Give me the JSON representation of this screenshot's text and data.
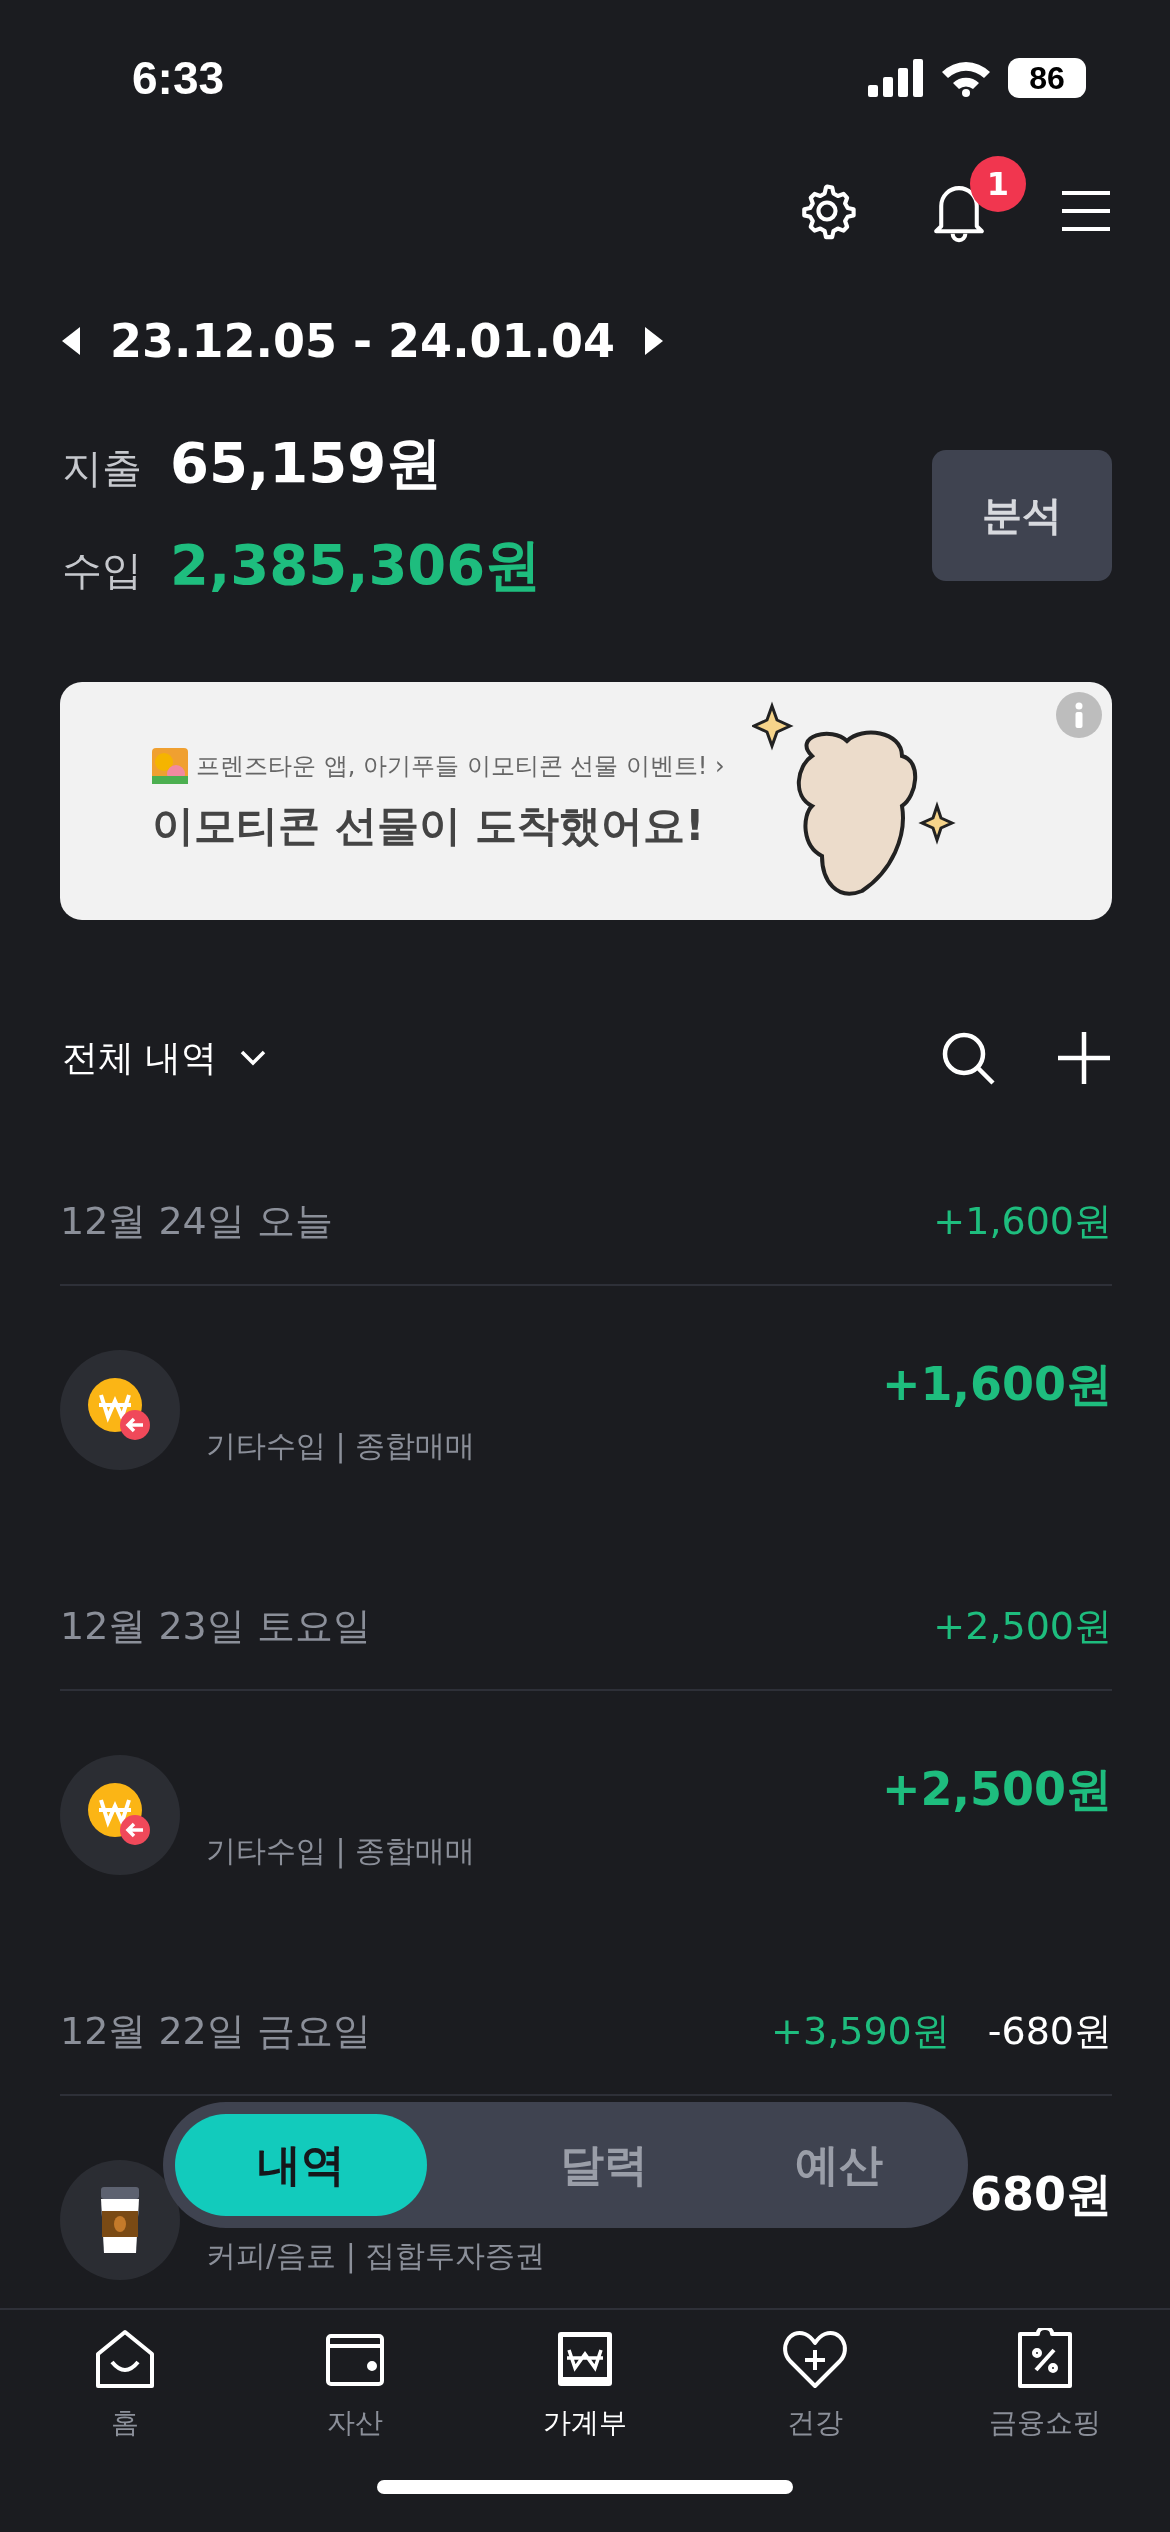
{
  "status_bar": {
    "time": "6:33",
    "battery": "86"
  },
  "header": {
    "notification_badge": "1"
  },
  "period": {
    "range": "23.12.05 - 24.01.04"
  },
  "summary": [
    {
      "label": "지출",
      "amount": "65,159원",
      "kind": "expense"
    },
    {
      "label": "수입",
      "amount": "2,385,306원",
      "kind": "income"
    }
  ],
  "analysis_button": "분석",
  "banner": {
    "subtitle": "프렌즈타운 앱, 아기푸들 이모티콘 선물 이벤트! ›",
    "title": "이모티콘 선물이 도착했어요!"
  },
  "list_header": {
    "filter": "전체 내역"
  },
  "groups": [
    {
      "date": "12월 24일 오늘",
      "totals": [
        {
          "text": "+1,600원",
          "kind": "income"
        }
      ],
      "items": [
        {
          "amount": "+1,600원",
          "kind": "income",
          "detail": "기타수입 | 종합매매"
        }
      ]
    },
    {
      "date": "12월 23일 토요일",
      "totals": [
        {
          "text": "+2,500원",
          "kind": "income"
        }
      ],
      "items": [
        {
          "amount": "+2,500원",
          "kind": "income",
          "detail": "기타수입 | 종합매매"
        }
      ]
    },
    {
      "date": "12월 22일 금요일",
      "totals": [
        {
          "text": "+3,590원",
          "kind": "income"
        },
        {
          "text": "-680원",
          "kind": "expense"
        }
      ],
      "items": [
        {
          "amount": "680원",
          "kind": "expense",
          "detail": "커피/음료 | 집합투자증권"
        }
      ]
    }
  ],
  "segments": [
    {
      "label": "내역",
      "selected": true
    },
    {
      "label": "달력",
      "selected": false
    },
    {
      "label": "예산",
      "selected": false
    }
  ],
  "nav": [
    {
      "label": "홈",
      "selected": false
    },
    {
      "label": "자산",
      "selected": false
    },
    {
      "label": "가계부",
      "selected": true
    },
    {
      "label": "건강",
      "selected": false
    },
    {
      "label": "금융쇼핑",
      "selected": false
    }
  ]
}
